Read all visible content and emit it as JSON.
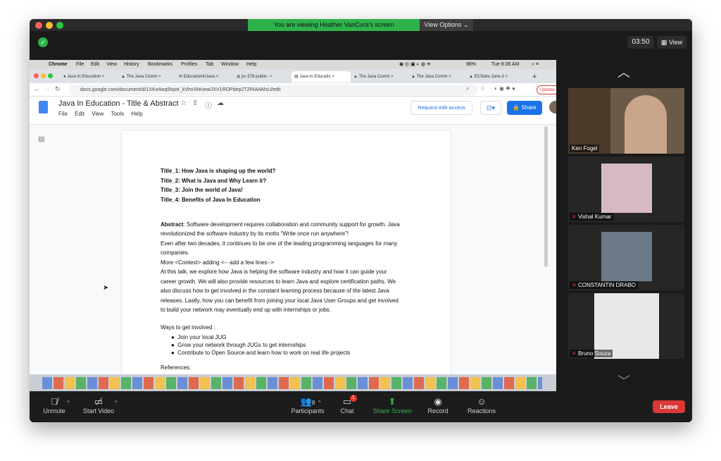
{
  "zoom": {
    "share_banner": "You are viewing Heather VanCura's screen",
    "view_options": "View Options ⌄",
    "timer": "03:50",
    "view_button": "View",
    "participants_count": "8",
    "chat_badge": "1",
    "toolbar": {
      "mute": "Unmute",
      "video": "Start Video",
      "participants": "Participants",
      "chat": "Chat",
      "share_screen": "Share Screen",
      "record": "Record",
      "reactions": "Reactions",
      "leave": "Leave"
    },
    "participants": [
      {
        "name": "Ken Fogel",
        "muted": false
      },
      {
        "name": "Vishal Kumar",
        "muted": true
      },
      {
        "name": "CONSTANTIN DRABO",
        "muted": true
      },
      {
        "name": "Bruno Souza",
        "muted": true
      }
    ],
    "colors": {
      "banner": "#2fb24b",
      "leave": "#d93a36",
      "share_screen": "#2fb24b"
    }
  },
  "mac_menu": {
    "app": "Chrome",
    "items": [
      "File",
      "Edit",
      "View",
      "History",
      "Bookmarks",
      "Profiles",
      "Tab",
      "Window",
      "Help"
    ],
    "battery": "98%",
    "clock": "Tue 8:35 AM"
  },
  "browser": {
    "tabs": [
      "Java In Education",
      "The Java Comm",
      "EducationInJava",
      "jsr-378-public-",
      "Java In Educatio",
      "The Java Comm",
      "The Java Comm",
      "ECStats-June-2"
    ],
    "url": "docs.google.com/document/d/1XKo4wq5lsjwI_kVhsVkKwwiJXV1ROPdep2T2RIAAMsU/edit",
    "update_button": "Update"
  },
  "doc": {
    "title": "Java In Education - Title & Abstract",
    "menus": [
      "File",
      "Edit",
      "View",
      "Tools",
      "Help"
    ],
    "request_edit": "Request edit access",
    "share": "Share",
    "titles": [
      "Title_1: How Java is shaping up the world?",
      "Title_2: What is Java and Why Learn it?",
      "Title_3: Join the world of Java!",
      "Title_4: Benefits of Java In Education"
    ],
    "abstract_label": "Abstract",
    "abstract_lines": [
      ": Software development requires collaboration and community support for growth. Java",
      "revolutionized the software industry by its motto “Write once run anywhere”!",
      "Even after two decades, it continues to be one of the leading programming languages for many",
      "companies.",
      "More <Context> adding <-- add a few lines-->",
      "At this talk, we explore how Java is helping the software industry and how it can guide your",
      "career growth. We will also provide resources to learn Java and explore certification paths. We",
      "also discuss how to get involved in the constant learning process because of the latest Java",
      "releases. Lastly, how you can benefit from joining your local Java User Groups and get involved",
      "to build your network may eventually end up with internships or jobs."
    ],
    "ways_heading": "Ways to get involved :",
    "ways": [
      "Join your local JUG",
      "Grow your network through JUGs to get internships",
      "Contribute to Open Source and learn how to work on real life projects"
    ],
    "references": "References:"
  }
}
